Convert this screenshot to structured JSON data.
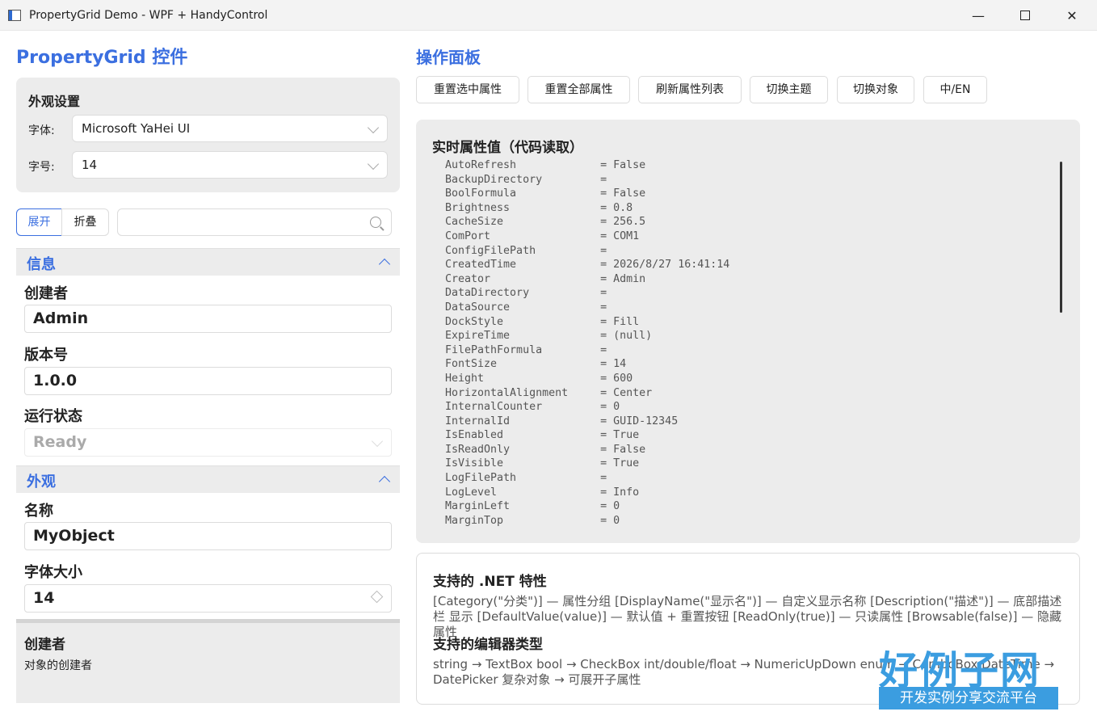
{
  "window": {
    "title": "PropertyGrid Demo - WPF + HandyControl",
    "min": "—",
    "close": "✕"
  },
  "left": {
    "heading": "PropertyGrid 控件",
    "appearance": {
      "title": "外观设置",
      "font_label": "字体:",
      "font_value": "Microsoft YaHei UI",
      "size_label": "字号:",
      "size_value": "14"
    },
    "toolbar": {
      "expand": "展开",
      "collapse": "折叠",
      "search_placeholder": ""
    },
    "categories": [
      {
        "name": "信息",
        "props": [
          {
            "label": "创建者",
            "value": "Admin",
            "editor": "text"
          },
          {
            "label": "版本号",
            "value": "1.0.0",
            "editor": "text"
          },
          {
            "label": "运行状态",
            "value": "Ready",
            "editor": "combo-disabled"
          }
        ]
      },
      {
        "name": "外观",
        "props": [
          {
            "label": "名称",
            "value": "MyObject",
            "editor": "text"
          },
          {
            "label": "字体大小",
            "value": "14",
            "editor": "numeric"
          }
        ]
      }
    ],
    "description": {
      "title": "创建者",
      "text": "对象的创建者"
    }
  },
  "right": {
    "heading": "操作面板",
    "buttons": [
      "重置选中属性",
      "重置全部属性",
      "刷新属性列表",
      "切换主题",
      "切换对象",
      "中/EN"
    ],
    "live": {
      "title": "实时属性值（代码读取）",
      "rows": [
        [
          "AutoRefresh",
          "False"
        ],
        [
          "BackupDirectory",
          ""
        ],
        [
          "BoolFormula",
          "False"
        ],
        [
          "Brightness",
          "0.8"
        ],
        [
          "CacheSize",
          "256.5"
        ],
        [
          "ComPort",
          "COM1"
        ],
        [
          "ConfigFilePath",
          ""
        ],
        [
          "CreatedTime",
          "2026/8/27 16:41:14"
        ],
        [
          "Creator",
          "Admin"
        ],
        [
          "DataDirectory",
          ""
        ],
        [
          "DataSource",
          ""
        ],
        [
          "DockStyle",
          "Fill"
        ],
        [
          "ExpireTime",
          "(null)"
        ],
        [
          "FilePathFormula",
          ""
        ],
        [
          "FontSize",
          "14"
        ],
        [
          "Height",
          "600"
        ],
        [
          "HorizontalAlignment",
          "Center"
        ],
        [
          "InternalCounter",
          "0"
        ],
        [
          "InternalId",
          "GUID-12345"
        ],
        [
          "IsEnabled",
          "True"
        ],
        [
          "IsReadOnly",
          "False"
        ],
        [
          "IsVisible",
          "True"
        ],
        [
          "LogFilePath",
          ""
        ],
        [
          "LogLevel",
          "Info"
        ],
        [
          "MarginLeft",
          "0"
        ],
        [
          "MarginTop",
          "0"
        ]
      ]
    },
    "net": {
      "h1": "支持的 .NET 特性",
      "p1": "[Category(\"分类\")] — 属性分组 [DisplayName(\"显示名\")] — 自定义显示名称 [Description(\"描述\")] — 底部描述栏 显示 [DefaultValue(value)] — 默认值 + 重置按钮 [ReadOnly(true)] — 只读属性 [Browsable(false)] — 隐藏属性",
      "h2": "支持的编辑器类型",
      "p2": "string → TextBox bool → CheckBox int/double/float → NumericUpDown enum → ComboBox DateTime → DatePicker 复杂对象 → 可展开子属性"
    }
  },
  "watermark": {
    "big": "好例子网",
    "small": "开发实例分享交流平台"
  }
}
